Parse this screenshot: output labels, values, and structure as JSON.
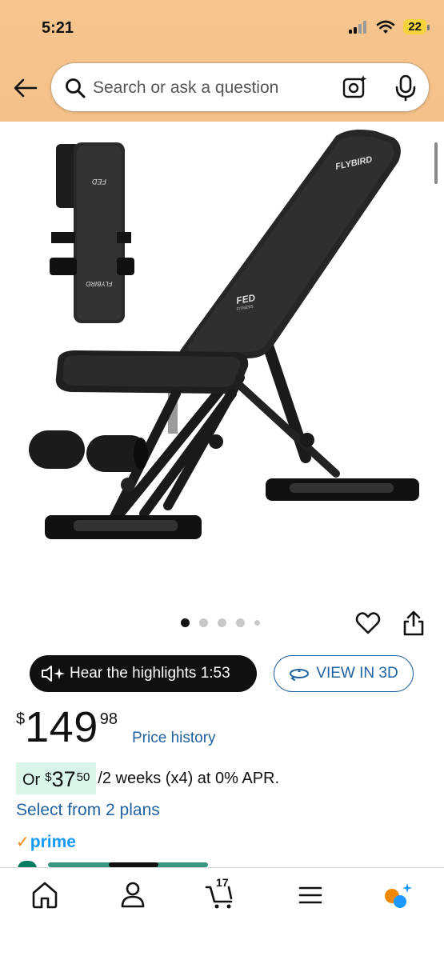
{
  "status_bar": {
    "time": "5:21",
    "battery": "22"
  },
  "search": {
    "placeholder": "Search or ask a question"
  },
  "product": {
    "image_brand": "FLYBIRD",
    "image_sub_brand": "FED",
    "image_sub_brand_tag": "FITNESS",
    "carousel_total": 5,
    "carousel_active": 1
  },
  "actions": {
    "hear_highlights": "Hear the highlights 1:53",
    "view_3d": "VIEW IN 3D"
  },
  "price": {
    "symbol": "$",
    "whole": "149",
    "fraction": "98",
    "history_link": "Price history"
  },
  "installment": {
    "prefix": "Or",
    "symbol": "$",
    "whole": "37",
    "fraction": "50",
    "terms": "/2 weeks (x4) at 0% APR."
  },
  "plans_link": "Select from 2 plans",
  "prime": {
    "label": "prime"
  },
  "bottom_nav": {
    "cart_count": "17"
  },
  "colors": {
    "header_bg": "#f6c68f",
    "link": "#2162a1",
    "installment_highlight": "#d9f5e8",
    "prime_blue": "#1399ff",
    "prime_check": "#f08804"
  }
}
